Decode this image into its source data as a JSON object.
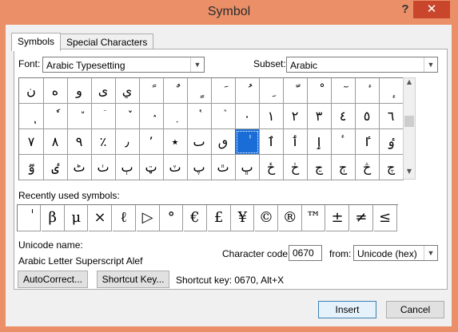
{
  "window": {
    "title": "Symbol",
    "help": "?",
    "close": "✕"
  },
  "tabs": [
    {
      "label": "Symbols",
      "active": true
    },
    {
      "label": "Special Characters",
      "active": false
    }
  ],
  "font": {
    "label": "Font:",
    "value": "Arabic Typesetting"
  },
  "subset": {
    "label": "Subset:",
    "value": "Arabic"
  },
  "grid": {
    "rows": [
      [
        "ن",
        "ه",
        "و",
        "ى",
        "ي",
        "ً",
        "ٌ",
        "ٍ",
        "َ",
        "ُ",
        "ِ",
        "ّ",
        "ْ",
        "ٓ",
        "ٔ",
        "ٕ"
      ],
      [
        "ٖ",
        "ٗ",
        "٘",
        "ٙ",
        "ٚ",
        "ٛ",
        "ٜ",
        "ٝ",
        "ٞ",
        "٠",
        "١",
        "٢",
        "٣",
        "٤",
        "٥",
        "٦"
      ],
      [
        "٧",
        "٨",
        "٩",
        "٪",
        "٫",
        "٬",
        "٭",
        "ٮ",
        "ٯ",
        "ٰ",
        "ٱ",
        "ٲ",
        "ٳ",
        "ٴ",
        "ٵ",
        "ٶ"
      ],
      [
        "ٷ",
        "ٸ",
        "ٹ",
        "ٺ",
        "ٻ",
        "ټ",
        "ٽ",
        "پ",
        "ٿ",
        "ڀ",
        "ځ",
        "ڂ",
        "ڃ",
        "ڄ",
        "څ",
        "چ"
      ]
    ],
    "selected": {
      "row": 2,
      "col": 9
    }
  },
  "recent": {
    "label": "Recently used symbols:",
    "symbols": [
      "ٰ",
      "β",
      "μ",
      "×",
      "ℓ",
      "▷",
      "°",
      "€",
      "£",
      "¥",
      "©",
      "®",
      "™",
      "±",
      "≠",
      "≤"
    ]
  },
  "unicode_name": {
    "label": "Unicode name:",
    "value": "Arabic Letter Superscript Alef"
  },
  "char_code": {
    "label": "Character code:",
    "value": "0670"
  },
  "from": {
    "label": "from:",
    "value": "Unicode (hex)"
  },
  "buttons": {
    "autocorrect": "AutoCorrect...",
    "shortcut_key": "Shortcut Key...",
    "insert": "Insert",
    "cancel": "Cancel"
  },
  "shortcut_text": "Shortcut key: 0670, Alt+X"
}
